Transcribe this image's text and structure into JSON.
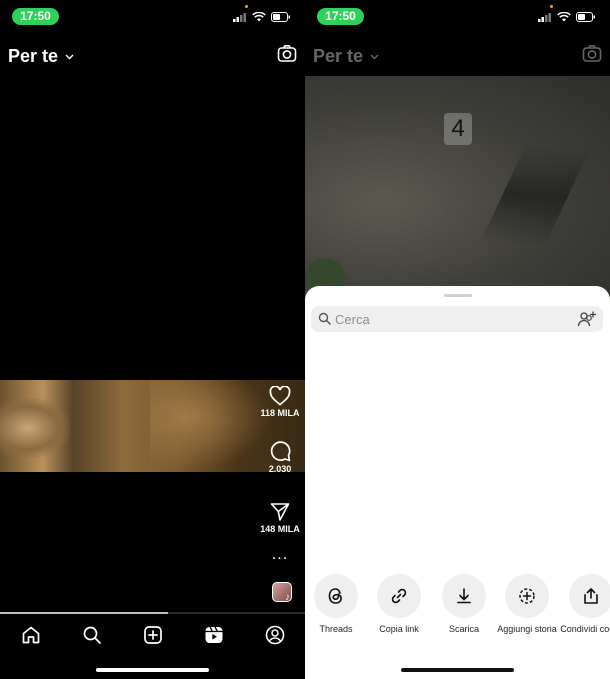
{
  "left": {
    "status": {
      "time": "17:50"
    },
    "header": {
      "title": "Per te"
    },
    "actions": {
      "likes": "118 MILA",
      "comments": "2.030",
      "shares": "148 MILA",
      "more": "..."
    },
    "progress": 0.55,
    "nav": [
      "home-icon",
      "search-icon",
      "create-icon",
      "reels-icon",
      "profile-icon"
    ]
  },
  "right": {
    "status": {
      "time": "17:50"
    },
    "header": {
      "title": "Per te"
    },
    "overlay_counter": "4",
    "sheet": {
      "search_placeholder": "Cerca",
      "share_options": [
        {
          "label": "Threads",
          "icon": "threads-icon"
        },
        {
          "label": "Copia link",
          "icon": "link-icon"
        },
        {
          "label": "Scarica",
          "icon": "download-icon"
        },
        {
          "label": "Aggiungi storia",
          "icon": "add-story-icon"
        },
        {
          "label": "Condividi con...",
          "icon": "share-icon"
        }
      ]
    }
  },
  "colors": {
    "time_pill": "#2fd15a",
    "sheet_bg": "#ffffff",
    "app_bg": "#000000"
  }
}
